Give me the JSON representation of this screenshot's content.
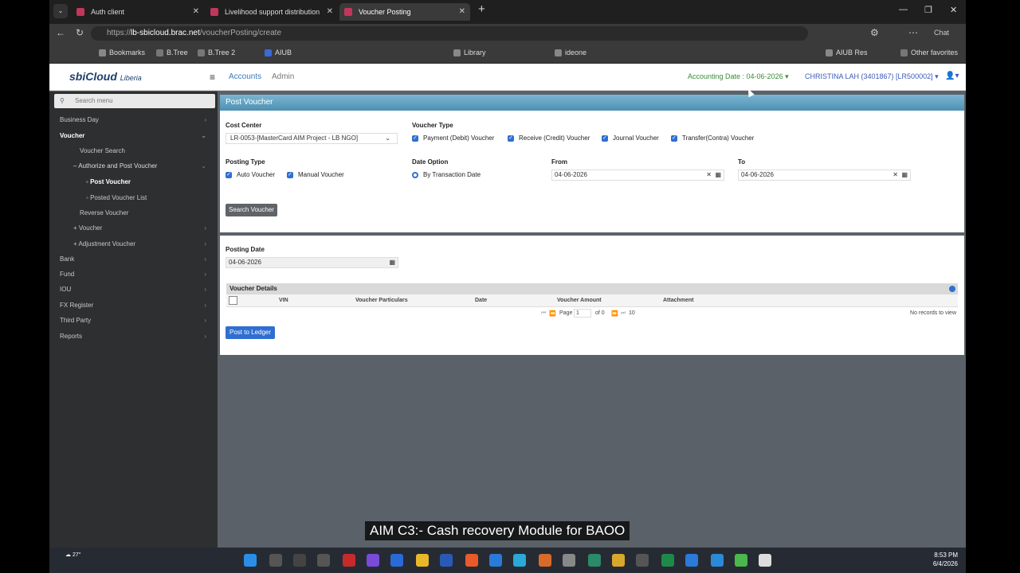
{
  "browser": {
    "tabs": [
      {
        "title": "Auth client",
        "active": false
      },
      {
        "title": "Livelihood support distribution",
        "active": false
      },
      {
        "title": "Voucher Posting",
        "active": true
      }
    ],
    "url_prefix": "https://",
    "url_host": "lb-sbicloud.brac.net",
    "url_path": "/voucherPosting/create",
    "chat_label": "Chat",
    "bookmarks": [
      "Bookmarks",
      "B.Tree",
      "B.Tree 2",
      "AIUB",
      "Library",
      "ideone",
      "AIUB Res",
      "Other favorites"
    ]
  },
  "app": {
    "logo_main": "sbiCloud",
    "logo_sub": "Liberia",
    "menu_accounts": "Accounts",
    "menu_admin": "Admin",
    "accounting_date": "Accounting Date : 04-06-2026",
    "user": "CHRISTINA LAH (3401867) [LR500002]"
  },
  "sidebar": {
    "search_placeholder": "Search menu",
    "items": [
      {
        "label": "Business Day"
      },
      {
        "label": "Voucher"
      },
      {
        "label": "Voucher Search"
      },
      {
        "label": "– Authorize and Post Voucher"
      },
      {
        "label": "Post Voucher"
      },
      {
        "label": "Posted Voucher List"
      },
      {
        "label": "Reverse Voucher"
      },
      {
        "label": "+ Voucher"
      },
      {
        "label": "+ Adjustment Voucher"
      },
      {
        "label": "Bank"
      },
      {
        "label": "Fund"
      },
      {
        "label": "IOU"
      },
      {
        "label": "FX Register"
      },
      {
        "label": "Third Party"
      },
      {
        "label": "Reports"
      }
    ]
  },
  "form": {
    "title": "Post Voucher",
    "cost_center_label": "Cost Center",
    "cost_center_value": "LR-0053-[MasterCard AIM Project - LB NGO]",
    "voucher_type_label": "Voucher Type",
    "voucher_types": [
      "Payment (Debit) Voucher",
      "Receive (Credit) Voucher",
      "Journal Voucher",
      "Transfer(Contra) Voucher"
    ],
    "posting_type_label": "Posting Type",
    "posting_types": [
      "Auto Voucher",
      "Manual Voucher"
    ],
    "date_option_label": "Date Option",
    "date_option_value": "By Transaction Date",
    "from_label": "From",
    "from_value": "04-06-2026",
    "to_label": "To",
    "to_value": "04-06-2026",
    "search_button": "Search Voucher",
    "posting_date_label": "Posting Date",
    "posting_date_value": "04-06-2026",
    "voucher_details_title": "Voucher Details",
    "columns": [
      "VIN",
      "Voucher Particulars",
      "Date",
      "Voucher Amount",
      "Attachment"
    ],
    "pager_page_label": "Page",
    "pager_page_value": "1",
    "pager_of": "of 0",
    "pager_size": "10",
    "no_records": "No records to view",
    "post_button": "Post to Ledger"
  },
  "taskbar": {
    "temperature": "27°",
    "time": "8:53 PM",
    "date": "6/4/2026"
  },
  "caption": "AIM C3:- Cash recovery Module for BAOO"
}
